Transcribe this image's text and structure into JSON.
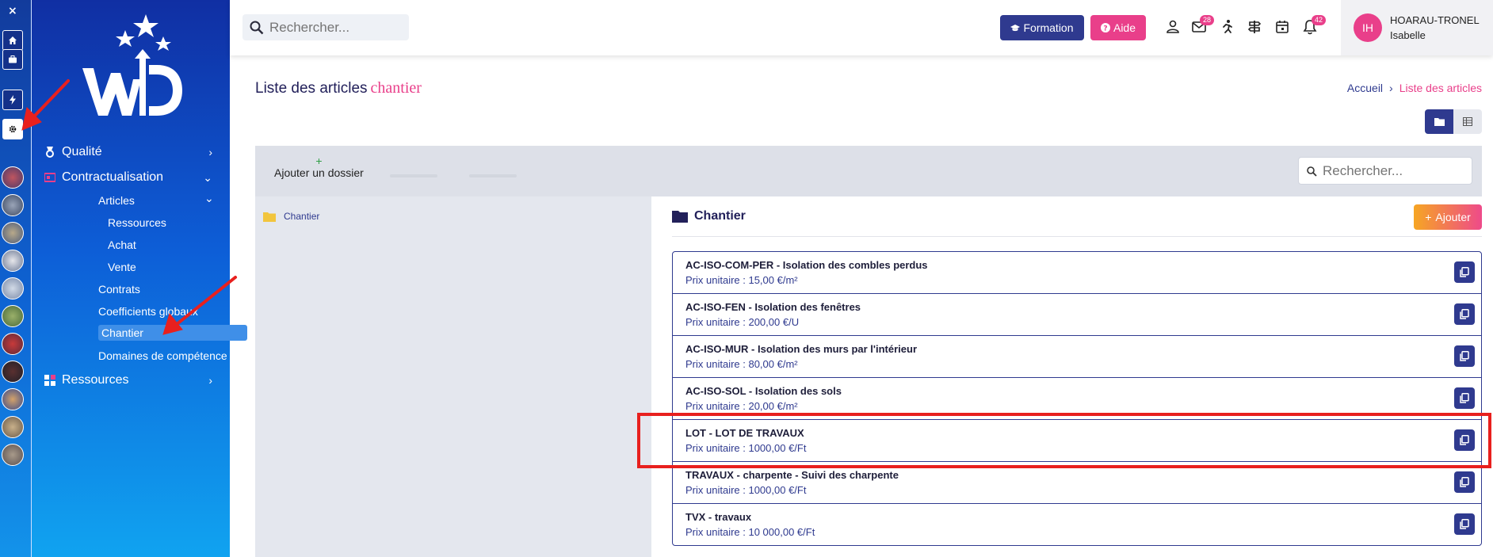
{
  "rail": {
    "close_label": "×",
    "buttons": [
      "home-icon",
      "briefcase-icon",
      "bolt-icon",
      "gear-icon"
    ]
  },
  "sidebar": {
    "menu": [
      {
        "label": "Qualité",
        "icon": "medal-icon"
      },
      {
        "label": "Contractualisation",
        "icon": "contract-icon"
      },
      {
        "label": "Ressources",
        "icon": "grid-icon"
      }
    ],
    "sub_items": {
      "articles": "Articles",
      "ressources": "Ressources",
      "achat": "Achat",
      "vente": "Vente",
      "contrats": "Contrats",
      "coefficients": "Coefficients globaux",
      "chantier": "Chantier",
      "domaines": "Domaines de compétence"
    }
  },
  "header": {
    "search_placeholder": "Rechercher...",
    "formation_label": "Formation",
    "aide_label": "Aide",
    "mail_count": "28",
    "notif_count": "42",
    "user": {
      "initials": "IH",
      "last_name": "HOARAU-TRONEL",
      "first_name": "Isabelle"
    }
  },
  "page": {
    "title": "Liste des articles",
    "title_accent": "chantier",
    "breadcrumb": {
      "home": "Accueil",
      "separator": "›",
      "current": "Liste des articles"
    }
  },
  "toolbar": {
    "add_folder_label": "Ajouter un dossier",
    "search_placeholder": "Rechercher..."
  },
  "tree": {
    "root_label": "Chantier"
  },
  "detail": {
    "title": "Chantier",
    "add_label": "Ajouter",
    "items": [
      {
        "name": "AC-ISO-COM-PER - Isolation des combles perdus",
        "price": "Prix unitaire : 15,00 €/m²"
      },
      {
        "name": "AC-ISO-FEN - Isolation des fenêtres",
        "price": "Prix unitaire : 200,00 €/U"
      },
      {
        "name": "AC-ISO-MUR - Isolation des murs par l'intérieur",
        "price": "Prix unitaire : 80,00 €/m²"
      },
      {
        "name": "AC-ISO-SOL - Isolation des sols",
        "price": "Prix unitaire : 20,00 €/m²"
      },
      {
        "name": "LOT - LOT DE TRAVAUX",
        "price": "Prix unitaire : 1000,00 €/Ft"
      },
      {
        "name": "TRAVAUX - charpente - Suivi des charpente",
        "price": "Prix unitaire : 1000,00 €/Ft"
      },
      {
        "name": "TVX - travaux",
        "price": "Prix unitaire : 10 000,00 €/Ft"
      }
    ]
  },
  "colors": {
    "primary": "#2f3a8f",
    "accent": "#e93f8a",
    "annotation": "#e8201e"
  }
}
